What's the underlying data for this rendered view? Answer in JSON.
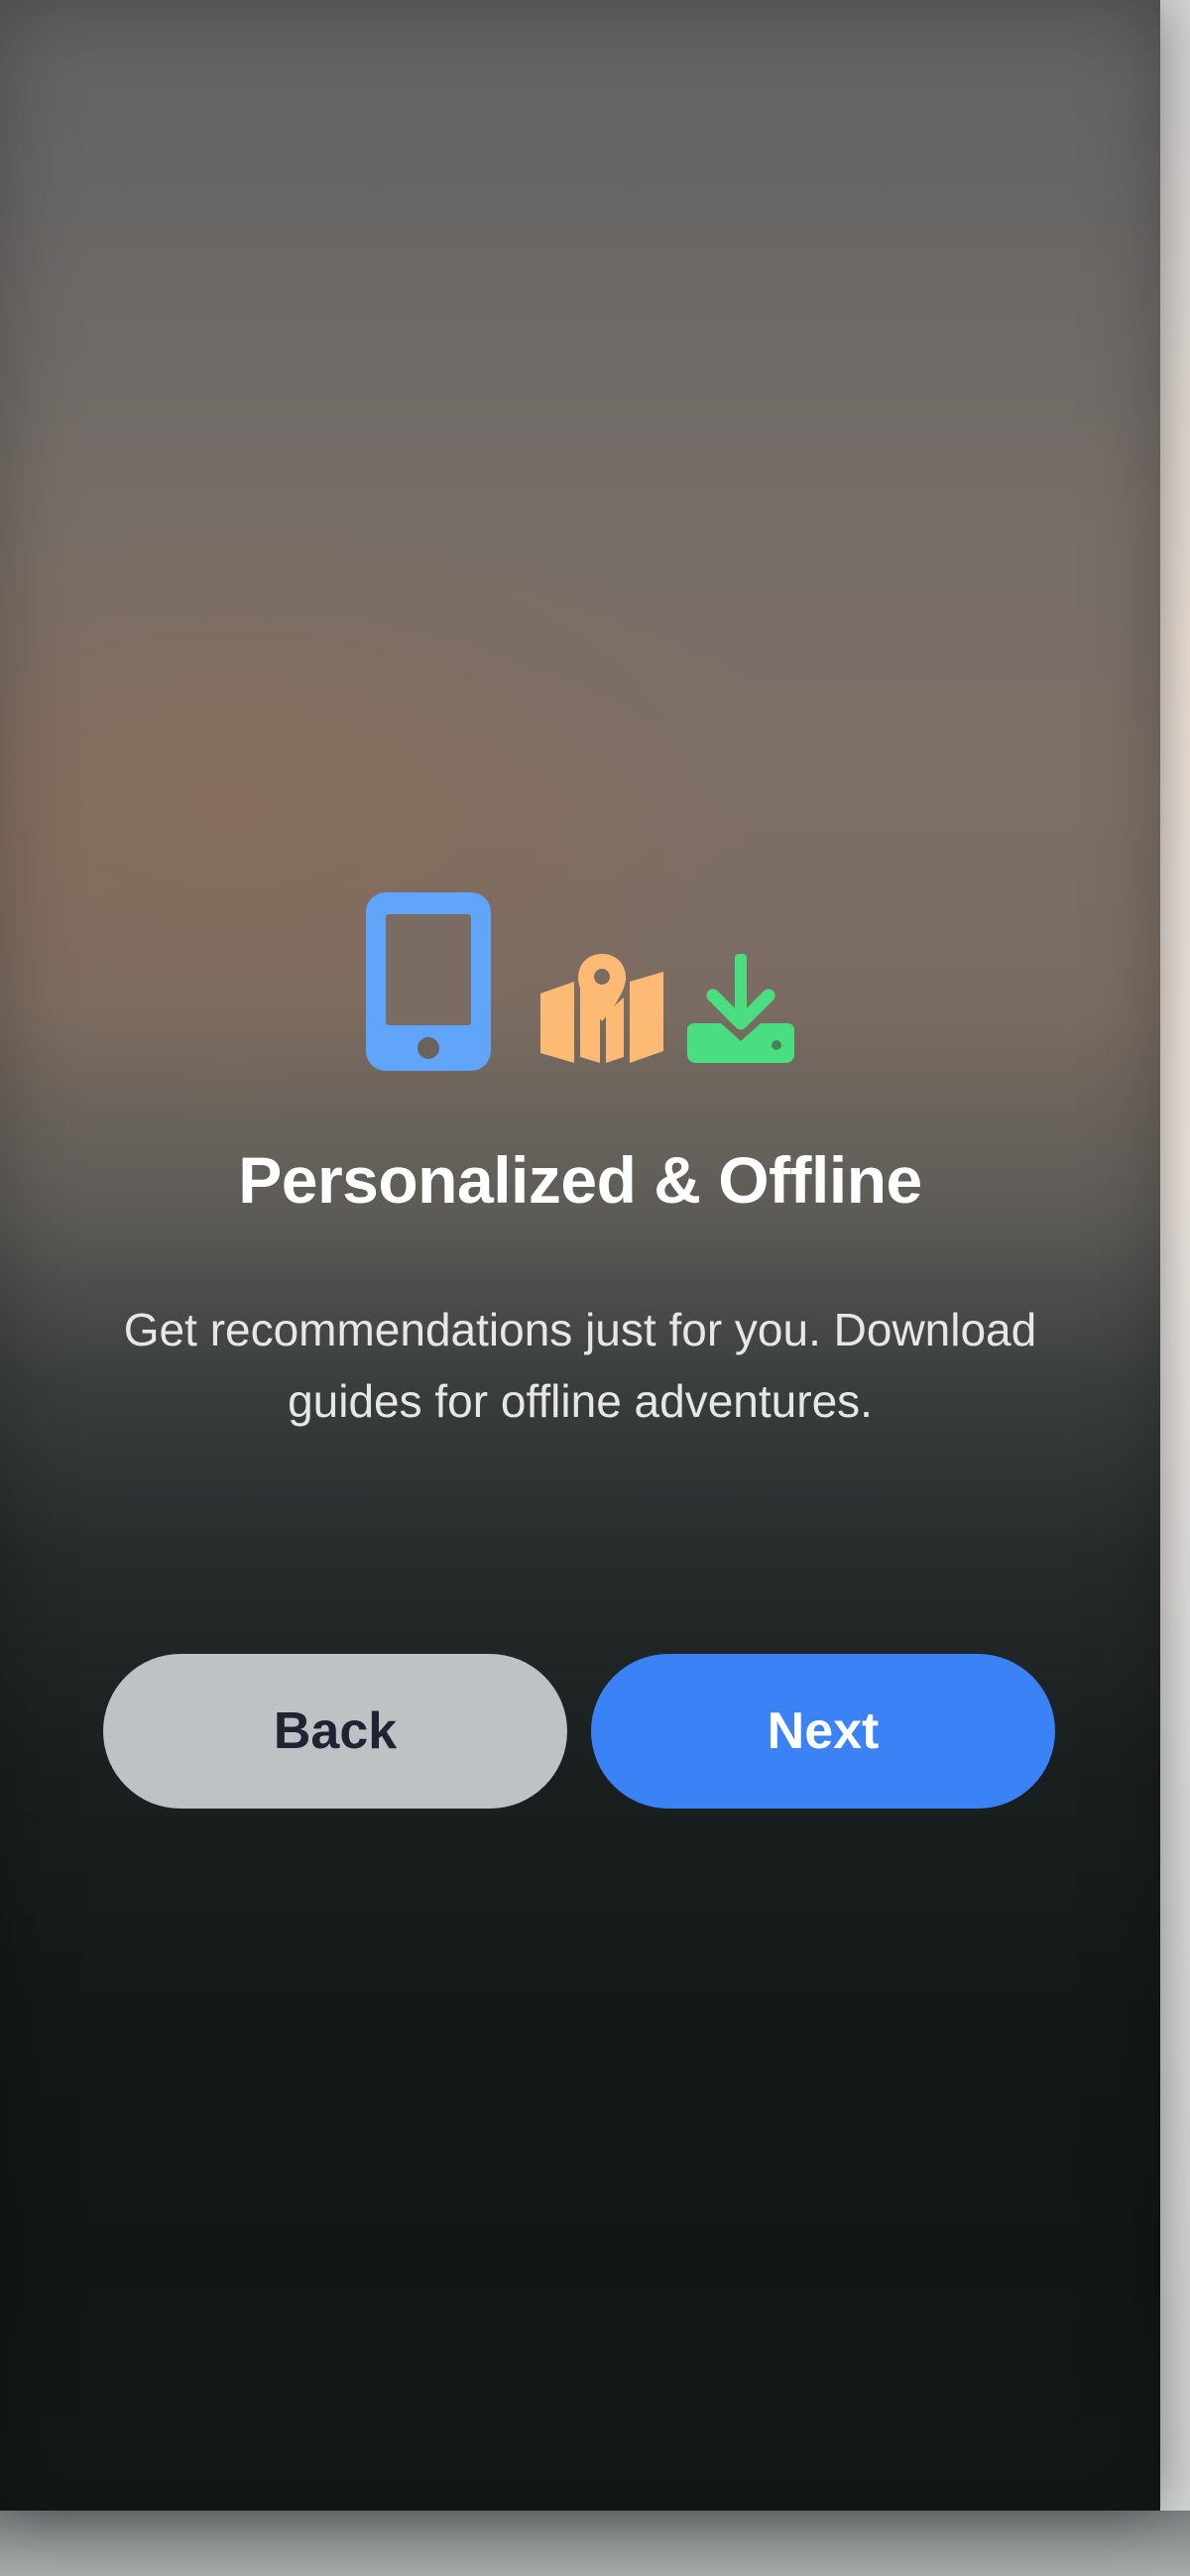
{
  "onboarding": {
    "title": "Personalized & Offline",
    "subtitle": "Get recommendations just for you. Download guides for offline adventures.",
    "icons": [
      "phone-icon",
      "map-pin-icon",
      "download-icon"
    ],
    "icon_colors": {
      "phone": "#60a5fa",
      "map": "#fdba74",
      "download": "#4ade80"
    }
  },
  "buttons": {
    "back_label": "Back",
    "next_label": "Next"
  },
  "colors": {
    "accent": "#3b82f6",
    "secondary_button": "#bfc2c4",
    "secondary_text": "#1f2433"
  }
}
